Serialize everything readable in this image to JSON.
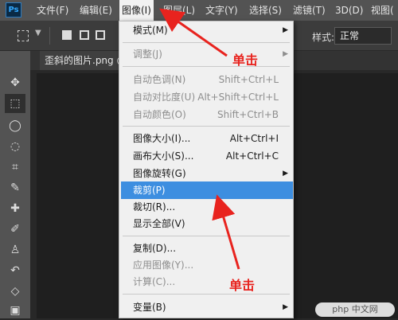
{
  "menubar": {
    "logo": "Ps",
    "items": [
      {
        "label": "文件(F)"
      },
      {
        "label": "编辑(E)"
      },
      {
        "label": "图像(I)"
      },
      {
        "label": "图层(L)"
      },
      {
        "label": "文字(Y)"
      },
      {
        "label": "选择(S)"
      },
      {
        "label": "滤镜(T)"
      },
      {
        "label": "3D(D)"
      },
      {
        "label": "视图("
      }
    ]
  },
  "options": {
    "style_label": "样式:",
    "style_value": "正常"
  },
  "document": {
    "tab_label": "歪斜的图片.png @"
  },
  "image_menu": {
    "items": [
      {
        "label": "模式(M)",
        "shortcut": "",
        "disabled": false,
        "submenu": true
      },
      {
        "label": "调整(J)",
        "shortcut": "",
        "disabled": true,
        "submenu": true
      },
      {
        "label": "自动色调(N)",
        "shortcut": "Shift+Ctrl+L",
        "disabled": true
      },
      {
        "label": "自动对比度(U)",
        "shortcut": "Alt+Shift+Ctrl+L",
        "disabled": true
      },
      {
        "label": "自动颜色(O)",
        "shortcut": "Shift+Ctrl+B",
        "disabled": true
      },
      {
        "label": "图像大小(I)...",
        "shortcut": "Alt+Ctrl+I",
        "disabled": false
      },
      {
        "label": "画布大小(S)...",
        "shortcut": "Alt+Ctrl+C",
        "disabled": false
      },
      {
        "label": "图像旋转(G)",
        "shortcut": "",
        "disabled": false,
        "submenu": true
      },
      {
        "label": "裁剪(P)",
        "shortcut": "",
        "disabled": false,
        "highlighted": true
      },
      {
        "label": "裁切(R)...",
        "shortcut": "",
        "disabled": false
      },
      {
        "label": "显示全部(V)",
        "shortcut": "",
        "disabled": false
      },
      {
        "label": "复制(D)...",
        "shortcut": "",
        "disabled": false
      },
      {
        "label": "应用图像(Y)...",
        "shortcut": "",
        "disabled": true
      },
      {
        "label": "计算(C)...",
        "shortcut": "",
        "disabled": true
      },
      {
        "label": "变量(B)",
        "shortcut": "",
        "disabled": false,
        "submenu": true
      }
    ]
  },
  "annotations": {
    "click1": "单击",
    "click2": "单击",
    "color": "#e8231e"
  },
  "watermark": "php 中文网",
  "icons": {
    "submenu_arrow": "▶",
    "chevron": "⌄"
  }
}
